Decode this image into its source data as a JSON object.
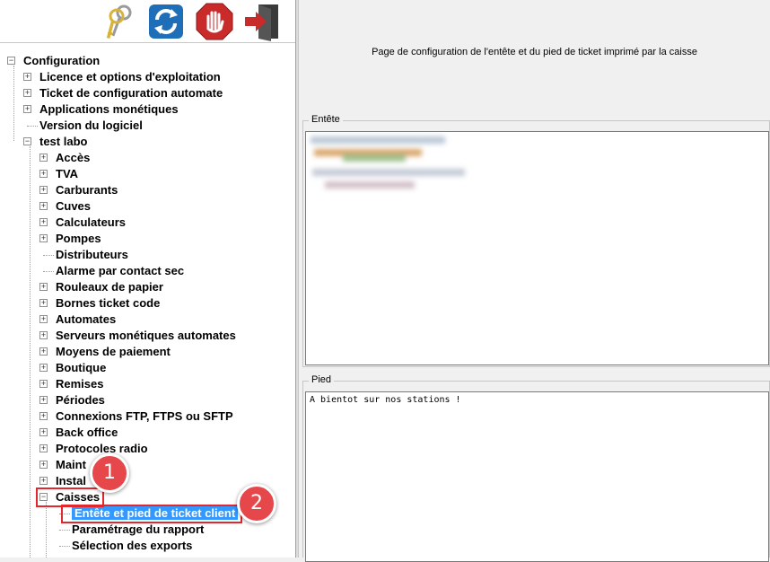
{
  "toolbar": {
    "buttons": [
      {
        "name": "keys-icon"
      },
      {
        "name": "refresh-icon"
      },
      {
        "name": "stop-icon"
      },
      {
        "name": "exit-icon"
      }
    ]
  },
  "tree": {
    "root": "Configuration",
    "items": [
      "Licence et options d'exploitation",
      "Ticket de configuration automate",
      "Applications monétiques",
      "Version du logiciel",
      "test labo"
    ],
    "labo_items": [
      "Accès",
      "TVA",
      "Carburants",
      "Cuves",
      "Calculateurs",
      "Pompes",
      "Distributeurs",
      "Alarme par contact sec",
      "Rouleaux de papier",
      "Bornes ticket code",
      "Automates",
      "Serveurs monétiques automates",
      "Moyens de paiement",
      "Boutique",
      "Remises",
      "Périodes",
      "Connexions FTP, FTPS ou SFTP",
      "Back office",
      "Protocoles radio",
      "Maint",
      "Instal",
      "Caisses"
    ],
    "caisses_items": [
      "Entête et pied de ticket client",
      "Paramétrage du rapport",
      "Sélection des exports"
    ]
  },
  "annotations": {
    "badge1": "1",
    "badge2": "2",
    "color": "#e5474b"
  },
  "main": {
    "description": "Page de configuration de l'entête et du pied de ticket imprimé par la caisse",
    "header_group": {
      "title": "Entête",
      "text": ""
    },
    "footer_group": {
      "title": "Pied",
      "text": "A bientot sur nos stations !"
    }
  }
}
